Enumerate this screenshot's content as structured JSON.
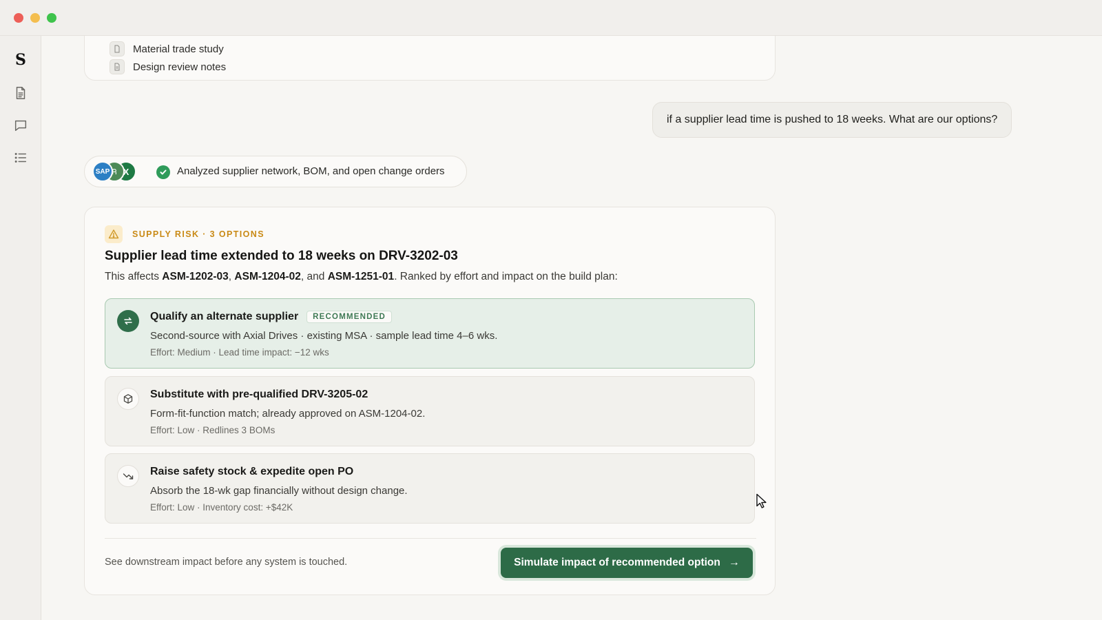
{
  "sidebar": {
    "logo": "S",
    "icons": [
      "document-icon",
      "chat-icon",
      "list-icon"
    ]
  },
  "top_card": {
    "items": [
      {
        "label": "Material trade study"
      },
      {
        "label": "Design review notes"
      }
    ]
  },
  "user_message": "if a supplier lead time is pushed to 18 weeks. What are our options?",
  "status": {
    "avatars": [
      "SAP",
      "",
      "X"
    ],
    "text": "Analyzed supplier network, BOM, and open change orders"
  },
  "risk_card": {
    "kicker": "SUPPLY RISK · 3 OPTIONS",
    "title": "Supplier lead time extended to 18 weeks on DRV-3202-03",
    "subtitle": {
      "prefix": "This affects ",
      "part1": "ASM-1202-03",
      "sep1": ", ",
      "part2": "ASM-1204-02",
      "sep2": ", and ",
      "part3": "ASM-1251-01",
      "suffix": ". Ranked by effort and impact on the build plan:"
    },
    "options": [
      {
        "title": "Qualify an alternate supplier",
        "badge": "RECOMMENDED",
        "description": "Second-source with Axial Drives · existing MSA · sample lead time 4–6 wks.",
        "meta": "Effort: Medium · Lead time impact: −12 wks",
        "icon": "swap-icon"
      },
      {
        "title": "Substitute with pre-qualified DRV-3205-02",
        "description": "Form-fit-function match; already approved on ASM-1204-02.",
        "meta": "Effort: Low · Redlines 3 BOMs",
        "icon": "box-icon"
      },
      {
        "title": "Raise safety stock & expedite open PO",
        "description": "Absorb the 18-wk gap financially without design change.",
        "meta": "Effort: Low · Inventory cost: +$42K",
        "icon": "trend-down-icon"
      }
    ],
    "footer_note": "See downstream impact before any system is touched.",
    "button_label": "Simulate impact of recommended option",
    "button_arrow": "→"
  },
  "colors": {
    "accent_green": "#2d6b47",
    "warning_amber": "#c98a16",
    "recommended_bg": "#e6efe8"
  }
}
